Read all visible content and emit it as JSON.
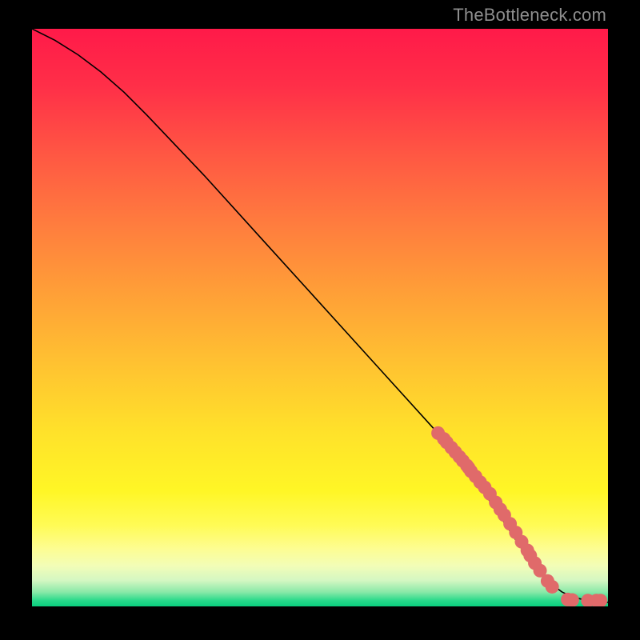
{
  "watermark": "TheBottleneck.com",
  "chart_data": {
    "type": "line",
    "title": "",
    "xlabel": "",
    "ylabel": "",
    "xlim": [
      0,
      100
    ],
    "ylim": [
      0,
      100
    ],
    "grid": false,
    "legend": false,
    "series": [
      {
        "name": "curve",
        "kind": "line",
        "color": "#000000",
        "x": [
          0,
          4,
          8,
          12,
          16,
          20,
          30,
          40,
          50,
          60,
          70,
          75,
          80,
          84,
          86,
          88,
          90,
          92,
          94,
          96,
          98,
          100
        ],
        "y": [
          100,
          98,
          95.5,
          92.5,
          89,
          85,
          74.5,
          63.5,
          52.5,
          41.5,
          30.5,
          24.5,
          17.5,
          11.5,
          8.5,
          6.0,
          4.0,
          2.5,
          1.6,
          1.1,
          0.8,
          0.7
        ]
      },
      {
        "name": "markers",
        "kind": "scatter",
        "color": "#e06a6a",
        "x": [
          70.5,
          71.5,
          72.0,
          72.8,
          73.5,
          74.2,
          74.8,
          75.5,
          75.8,
          76.2,
          77.0,
          77.8,
          78.6,
          79.5,
          80.5,
          81.3,
          82.0,
          83.0,
          84.0,
          85.0,
          86.0,
          86.5,
          87.3,
          88.2,
          89.5,
          90.3,
          93.0,
          93.8,
          96.5,
          98.0,
          98.7
        ],
        "y": [
          30.0,
          29.0,
          28.4,
          27.5,
          26.7,
          25.9,
          25.2,
          24.4,
          24.0,
          23.4,
          22.5,
          21.5,
          20.6,
          19.5,
          18.0,
          16.8,
          15.8,
          14.3,
          12.8,
          11.2,
          9.7,
          8.8,
          7.5,
          6.2,
          4.4,
          3.4,
          1.2,
          1.1,
          1.0,
          1.0,
          1.0
        ]
      }
    ],
    "background_gradient": {
      "stops": [
        {
          "pct": 0.0,
          "color": "#ff1a49"
        },
        {
          "pct": 0.1,
          "color": "#ff2f48"
        },
        {
          "pct": 0.22,
          "color": "#ff5843"
        },
        {
          "pct": 0.34,
          "color": "#ff7d3e"
        },
        {
          "pct": 0.46,
          "color": "#ffa037"
        },
        {
          "pct": 0.58,
          "color": "#ffc231"
        },
        {
          "pct": 0.7,
          "color": "#ffe22a"
        },
        {
          "pct": 0.8,
          "color": "#fff626"
        },
        {
          "pct": 0.86,
          "color": "#fffb56"
        },
        {
          "pct": 0.9,
          "color": "#fdfd92"
        },
        {
          "pct": 0.93,
          "color": "#f2fdb7"
        },
        {
          "pct": 0.955,
          "color": "#d4f7c2"
        },
        {
          "pct": 0.975,
          "color": "#8ae9a8"
        },
        {
          "pct": 0.99,
          "color": "#28d98a"
        },
        {
          "pct": 1.0,
          "color": "#09cf7e"
        }
      ]
    }
  }
}
